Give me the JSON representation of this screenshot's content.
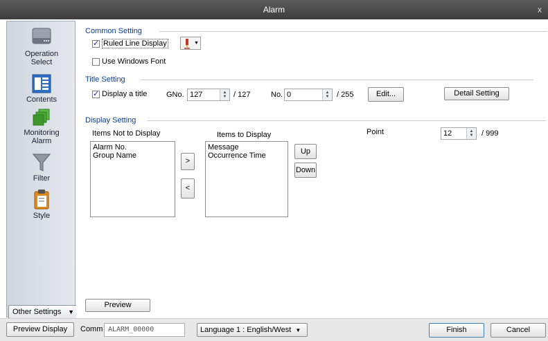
{
  "window": {
    "title": "Alarm",
    "close_glyph": "x"
  },
  "sidebar": {
    "items": [
      {
        "label_line1": "Operation",
        "label_line2": "Select",
        "icon": "drive-icon"
      },
      {
        "label_line1": "Contents",
        "label_line2": "",
        "icon": "document-list-icon"
      },
      {
        "label_line1": "Monitoring",
        "label_line2": "Alarm",
        "icon": "stacked-squares-icon"
      },
      {
        "label_line1": "Filter",
        "label_line2": "",
        "icon": "funnel-icon"
      },
      {
        "label_line1": "Style",
        "label_line2": "",
        "icon": "clipboard-icon"
      }
    ],
    "other_settings_label": "Other Settings"
  },
  "common": {
    "title": "Common Setting",
    "ruled_line_label": "Ruled Line Display",
    "ruled_line_checked": true,
    "windows_font_label": "Use Windows Font",
    "windows_font_checked": false
  },
  "title_setting": {
    "title": "Title Setting",
    "display_title_label": "Display a title",
    "display_title_checked": true,
    "gno_label": "GNo.",
    "gno_value": "127",
    "gno_max": "/ 127",
    "no_label": "No.",
    "no_value": "0",
    "no_max": "/ 255",
    "edit_label": "Edit...",
    "detail_label": "Detail Setting"
  },
  "display_setting": {
    "title": "Display Setting",
    "not_display_header": "Items Not to Display",
    "not_display_items": [
      "Alarm No.",
      "Group Name"
    ],
    "display_header": "Items to Display",
    "display_items": [
      "Message",
      "Occurrence Time"
    ],
    "move_right": ">",
    "move_left": "<",
    "up_label": "Up",
    "down_label": "Down",
    "point_label": "Point",
    "point_value": "12",
    "point_max": "/ 999"
  },
  "preview_label": "Preview",
  "bottom": {
    "preview_display_label": "Preview Display",
    "comm_label": "Comm",
    "comm_value": "ALARM_00000",
    "language_value": "Language 1 : English/West",
    "finish_label": "Finish",
    "cancel_label": "Cancel"
  },
  "colors": {
    "section_title": "#0b3d91",
    "titlebar": "#4a4a4a"
  }
}
